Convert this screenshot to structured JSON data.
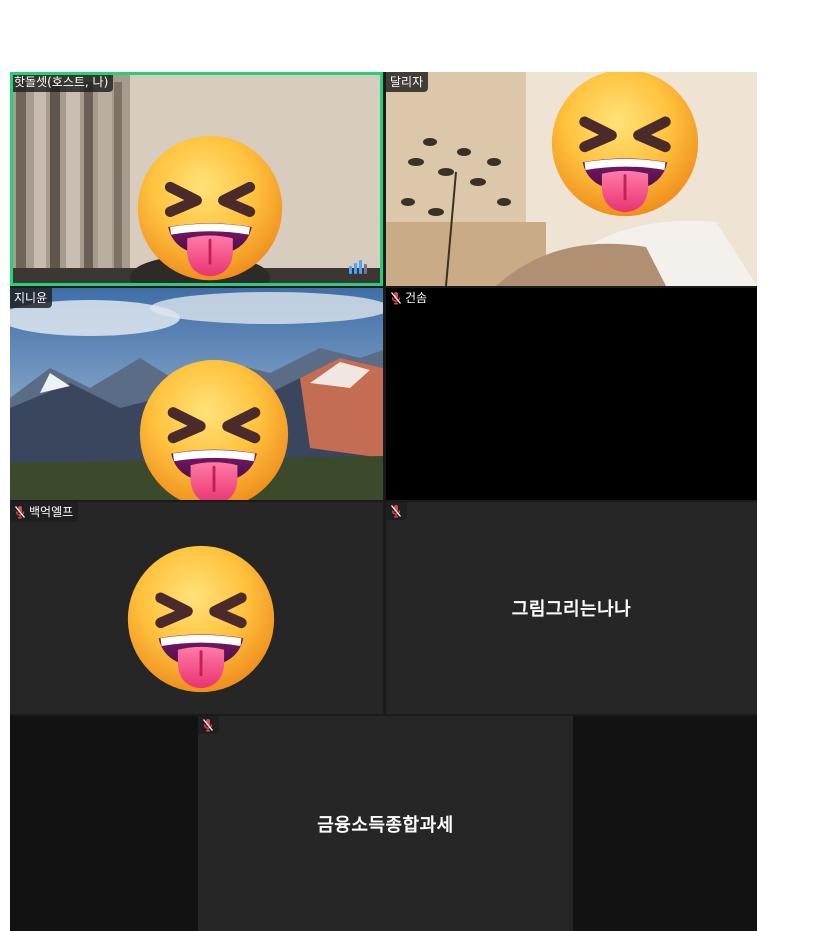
{
  "participants": [
    {
      "name": "핫돌셋(호스트, 나)",
      "muted": false,
      "video": true,
      "speaking": true,
      "icon": "curtain-room-video"
    },
    {
      "name": "달리자",
      "muted": false,
      "video": true,
      "speaking": false,
      "icon": "room-plant-video"
    },
    {
      "name": "지니윤",
      "muted": false,
      "video": true,
      "speaking": false,
      "icon": "mountain-landscape-video"
    },
    {
      "name": "건솜",
      "muted": true,
      "video": false,
      "speaking": false,
      "icon": "black-video"
    },
    {
      "name": "백억엘프",
      "muted": true,
      "video": false,
      "speaking": false,
      "icon": "dark-tile"
    },
    {
      "name": "",
      "display_name": "그림그리는나나",
      "muted": true,
      "video": false,
      "speaking": false
    },
    {
      "name": "",
      "display_name": "금융소득종합과세",
      "muted": true,
      "video": false,
      "speaking": false
    }
  ],
  "colors": {
    "speaking_border": "#22d17a",
    "muted_icon": "#e0464b",
    "tile_dark": "#262626",
    "tile_black": "#000000"
  },
  "icons": {
    "mic_off": "mic-off-icon",
    "audio": "audio-level-icon",
    "emoji": "squinting-face-with-tongue-emoji"
  }
}
